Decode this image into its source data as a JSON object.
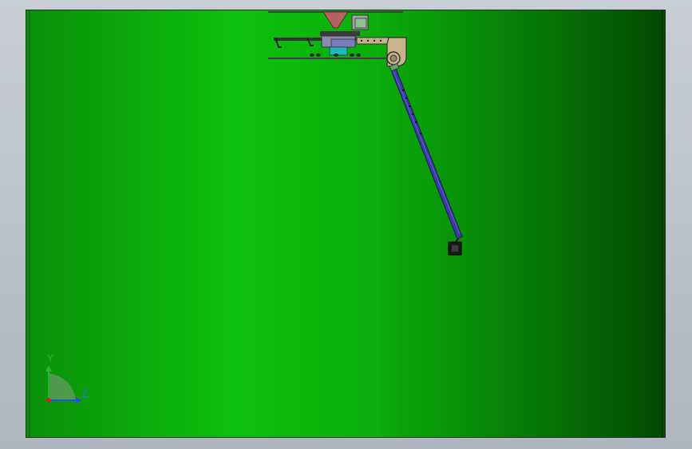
{
  "colors": {
    "viewport_background": "#0cc20c",
    "arm": "#3a3aa8",
    "triad_x": "#d02020",
    "triad_y": "#2bb52b",
    "triad_z": "#2a4fd6"
  },
  "triad": {
    "y_label": "Y",
    "z_label": "Z"
  }
}
